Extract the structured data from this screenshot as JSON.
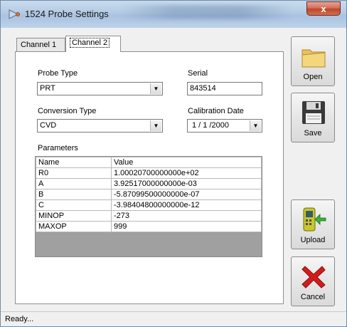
{
  "window": {
    "title": "1524 Probe Settings",
    "close_label": "x"
  },
  "tabs": [
    {
      "label": "Channel 1",
      "selected": false
    },
    {
      "label": "Channel 2",
      "selected": true
    }
  ],
  "form": {
    "probe_type_label": "Probe Type",
    "probe_type_value": "PRT",
    "serial_label": "Serial",
    "serial_value": "843514",
    "conversion_type_label": "Conversion Type",
    "conversion_type_value": "CVD",
    "calibration_date_label": "Calibration Date",
    "calibration_date_value": "1 / 1 /2000"
  },
  "parameters": {
    "label": "Parameters",
    "headers": [
      "Name",
      "Value"
    ],
    "rows": [
      {
        "name": "R0",
        "value": "1.00020700000000e+02"
      },
      {
        "name": "A",
        "value": "3.92517000000000e-03"
      },
      {
        "name": "B",
        "value": "-5.87099500000000e-07"
      },
      {
        "name": "C",
        "value": "-3.98404800000000e-12"
      },
      {
        "name": "MINOP",
        "value": "-273"
      },
      {
        "name": "MAXOP",
        "value": "999"
      }
    ]
  },
  "buttons": {
    "open": "Open",
    "save": "Save",
    "upload": "Upload",
    "cancel": "Cancel"
  },
  "status": "Ready..."
}
